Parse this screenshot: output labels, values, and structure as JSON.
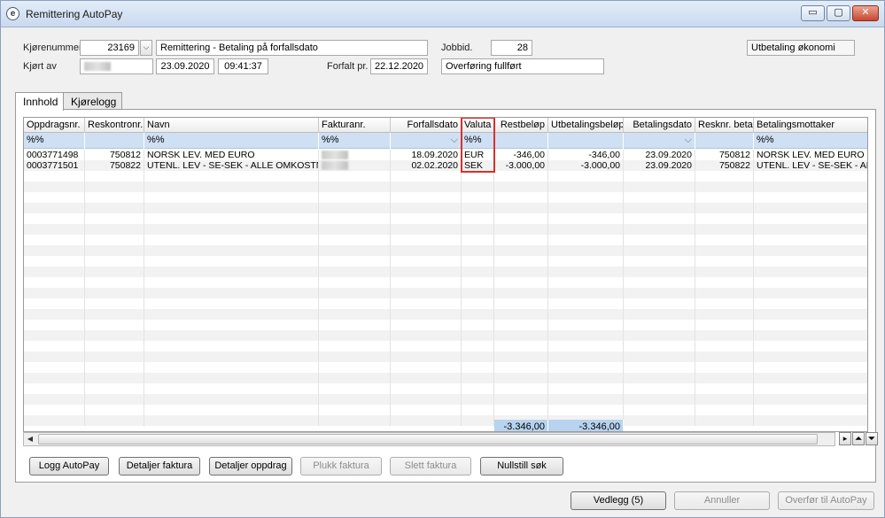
{
  "window": {
    "title": "Remittering AutoPay",
    "app_icon": "e",
    "controls": {
      "minimize": "▭",
      "maximize": "▢",
      "close": "✕"
    }
  },
  "header": {
    "kjorenummer_label": "Kjørenummer",
    "kjorenummer_value": "23169",
    "kjorenummer_desc": "Remittering - Betaling på forfallsdato",
    "kjort_av_label": "Kjørt av",
    "date": "23.09.2020",
    "time": "09:41:37",
    "forfalt_label": "Forfalt pr.",
    "forfalt_value": "22.12.2020",
    "jobbid_label": "Jobbid.",
    "jobbid_value": "28",
    "status": "Overføring fullført",
    "type": "Utbetaling økonomi"
  },
  "tabs": [
    {
      "label": "Innhold"
    },
    {
      "label": "Kjørelogg"
    }
  ],
  "grid": {
    "columns": [
      {
        "label": "Oppdragsnr."
      },
      {
        "label": "Reskontronr."
      },
      {
        "label": "Navn"
      },
      {
        "label": "Fakturanr."
      },
      {
        "label": "Forfallsdato"
      },
      {
        "label": "Valuta"
      },
      {
        "label": "Restbeløp"
      },
      {
        "label": "Utbetalingsbeløp"
      },
      {
        "label": "Betalingsdato"
      },
      {
        "label": "Resknr. betali"
      },
      {
        "label": "Betalingsmottaker"
      }
    ],
    "filters": {
      "oppdragsnr": "%%",
      "navn": "%%",
      "fakturanr": "%%",
      "valuta": "%%",
      "mottaker": "%%"
    },
    "rows": [
      {
        "oppdragsnr": "0003771498",
        "reskontronr": "750812",
        "navn": "NORSK LEV. MED EURO",
        "forfallsdato": "18.09.2020",
        "valuta": "EUR",
        "restbelop": "-346,00",
        "utbetalingsbelop": "-346,00",
        "betalingsdato": "23.09.2020",
        "resknr_betali": "750812",
        "mottaker": "NORSK LEV. MED EURO"
      },
      {
        "oppdragsnr": "0003771501",
        "reskontronr": "750822",
        "navn": "UTENL. LEV - SE-SEK - ALLE OMKOSTNINGER",
        "forfallsdato": "02.02.2020",
        "valuta": "SEK",
        "restbelop": "-3.000,00",
        "utbetalingsbelop": "-3.000,00",
        "betalingsdato": "23.09.2020",
        "resknr_betali": "750822",
        "mottaker": "UTENL. LEV - SE-SEK - ALLE"
      }
    ],
    "totals": {
      "restbelop": "-3.346,00",
      "utbetalingsbelop": "-3.346,00"
    },
    "dropdown_glyph": "⌵",
    "scroll_left": "◀",
    "nav_right": "▸",
    "nav_up": "⏶",
    "nav_down": "⏷"
  },
  "buttons": {
    "logg_autopay": "Logg AutoPay",
    "detaljer_faktura": "Detaljer faktura",
    "detaljer_oppdrag": "Detaljer oppdrag",
    "plukk_faktura": "Plukk faktura",
    "slett_faktura": "Slett faktura",
    "nullstill_sok": "Nullstill søk",
    "vedlegg": "Vedlegg (5)",
    "annuller": "Annuller",
    "overfor": "Overfør til AutoPay"
  },
  "colors": {
    "highlight_box": "#d9302b",
    "filter_row": "#cfe0f4",
    "totals": "#b7d3ef"
  }
}
